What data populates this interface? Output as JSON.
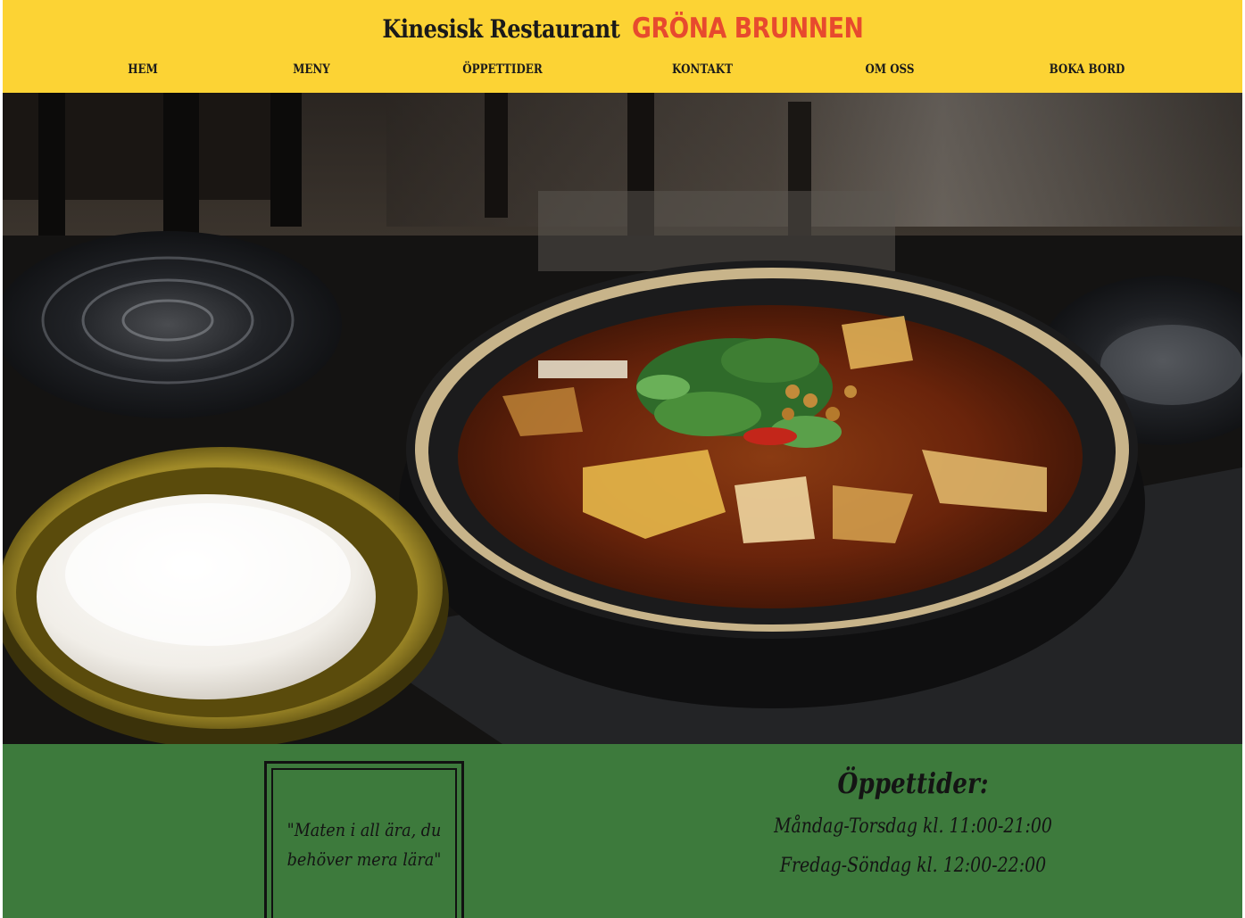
{
  "header": {
    "title": "Kinesisk Restaurant",
    "brand": "GRÖNA BRUNNEN"
  },
  "nav": {
    "items": [
      {
        "label": "HEM"
      },
      {
        "label": "MENY"
      },
      {
        "label": "ÖPPETTIDER"
      },
      {
        "label": "KONTAKT"
      },
      {
        "label": "OM OSS"
      },
      {
        "label": "BOKA BORD"
      }
    ]
  },
  "hero": {
    "icon": "food-photo-icon"
  },
  "quote": {
    "text": "\"Maten i all ära, du behöver mera lära\""
  },
  "hours": {
    "title": "Öppettider:",
    "lines": [
      "Måndag-Torsdag kl. 11:00-21:00",
      "Fredag-Söndag kl. 12:00-22:00"
    ]
  },
  "colors": {
    "header_bg": "#fcd334",
    "brand_accent": "#e74a2e",
    "footer_bg": "#3d7a3c",
    "text": "#141414"
  }
}
